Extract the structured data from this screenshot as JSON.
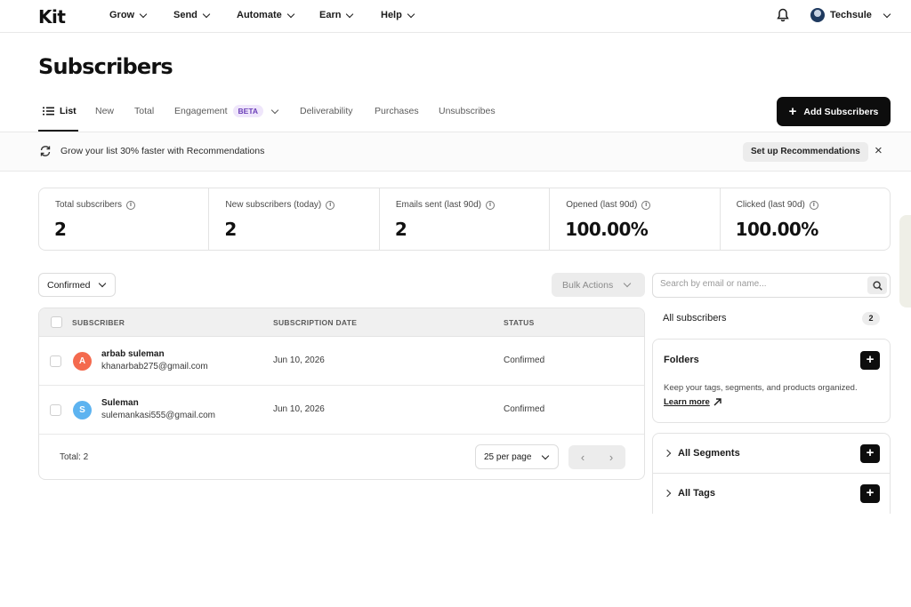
{
  "nav": {
    "logo": "Kit",
    "items": [
      {
        "label": "Grow"
      },
      {
        "label": "Send"
      },
      {
        "label": "Automate"
      },
      {
        "label": "Earn"
      },
      {
        "label": "Help"
      }
    ],
    "user_name": "Techsule"
  },
  "page": {
    "title": "Subscribers",
    "tabs": [
      {
        "label": "List"
      },
      {
        "label": "New"
      },
      {
        "label": "Total"
      },
      {
        "label": "Engagement"
      },
      {
        "label": "Deliverability"
      },
      {
        "label": "Purchases"
      },
      {
        "label": "Unsubscribes"
      }
    ],
    "beta_badge": "BETA",
    "add_button": "Add Subscribers"
  },
  "banner": {
    "text": "Grow your list 30% faster with Recommendations",
    "setup_button": "Set up Recommendations",
    "close": "×"
  },
  "stats": [
    {
      "label": "Total subscribers",
      "value": "2"
    },
    {
      "label": "New subscribers (today)",
      "value": "2"
    },
    {
      "label": "Emails sent (last 90d)",
      "value": "2"
    },
    {
      "label": "Opened (last 90d)",
      "value": "100.00%"
    },
    {
      "label": "Clicked (last 90d)",
      "value": "100.00%"
    }
  ],
  "filters": {
    "status_select": "Confirmed",
    "bulk_actions": "Bulk Actions"
  },
  "table": {
    "headers": {
      "subscriber": "SUBSCRIBER",
      "date": "SUBSCRIPTION DATE",
      "status": "STATUS"
    },
    "rows": [
      {
        "initial": "A",
        "name": "arbab suleman",
        "email": "khanarbab275@gmail.com",
        "date": "Jun 10, 2026",
        "status": "Confirmed",
        "color": "#f46a4e"
      },
      {
        "initial": "S",
        "name": "Suleman",
        "email": "sulemankasi555@gmail.com",
        "date": "Jun 10, 2026",
        "status": "Confirmed",
        "color": "#5db3f0"
      }
    ],
    "total": "Total: 2",
    "per_page": "25 per page",
    "prev": "‹",
    "next": "›"
  },
  "sidebar": {
    "search_placeholder": "Search by email or name...",
    "all_subscribers": "All subscribers",
    "all_count": "2",
    "folders_title": "Folders",
    "folders_desc": "Keep your tags, segments, and products organized.",
    "learn_more": "Learn more",
    "segments": "All Segments",
    "tags": "All Tags",
    "plus": "+"
  }
}
